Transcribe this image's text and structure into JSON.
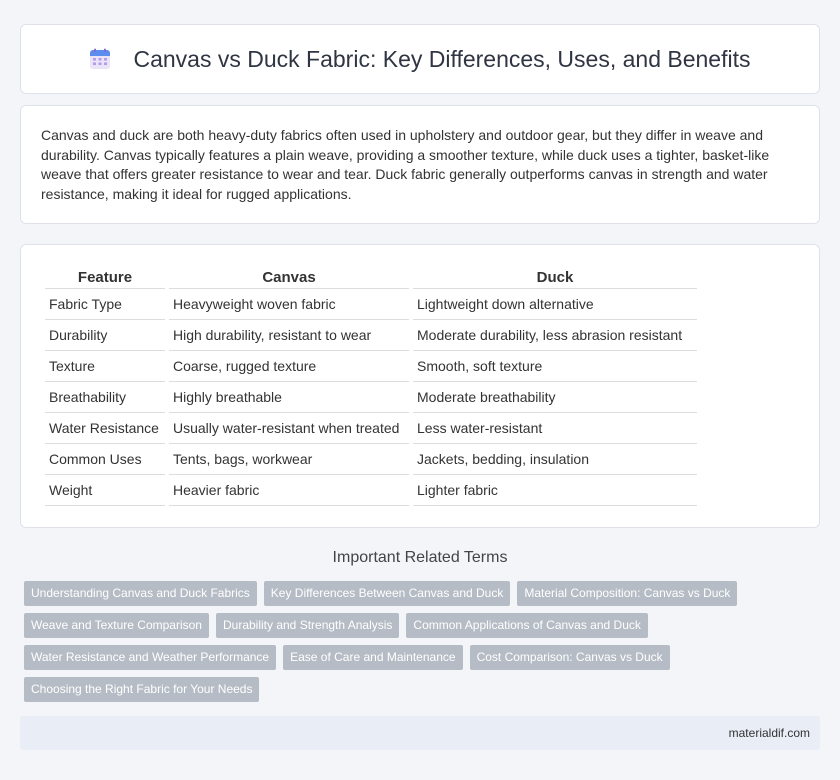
{
  "header": {
    "title": "Canvas vs Duck Fabric: Key Differences, Uses, and Benefits",
    "icon": "calendar-icon"
  },
  "intro": {
    "text": "Canvas and duck are both heavy-duty fabrics often used in upholstery and outdoor gear, but they differ in weave and durability. Canvas typically features a plain weave, providing a smoother texture, while duck uses a tighter, basket-like weave that offers greater resistance to wear and tear. Duck fabric generally outperforms canvas in strength and water resistance, making it ideal for rugged applications."
  },
  "table": {
    "headers": [
      "Feature",
      "Canvas",
      "Duck"
    ],
    "rows": [
      [
        "Fabric Type",
        "Heavyweight woven fabric",
        "Lightweight down alternative"
      ],
      [
        "Durability",
        "High durability, resistant to wear",
        "Moderate durability, less abrasion resistant"
      ],
      [
        "Texture",
        "Coarse, rugged texture",
        "Smooth, soft texture"
      ],
      [
        "Breathability",
        "Highly breathable",
        "Moderate breathability"
      ],
      [
        "Water Resistance",
        "Usually water-resistant when treated",
        "Less water-resistant"
      ],
      [
        "Common Uses",
        "Tents, bags, workwear",
        "Jackets, bedding, insulation"
      ],
      [
        "Weight",
        "Heavier fabric",
        "Lighter fabric"
      ]
    ]
  },
  "related": {
    "title": "Important Related Terms",
    "tags": [
      "Understanding Canvas and Duck Fabrics",
      "Key Differences Between Canvas and Duck",
      "Material Composition: Canvas vs Duck",
      "Weave and Texture Comparison",
      "Durability and Strength Analysis",
      "Common Applications of Canvas and Duck",
      "Water Resistance and Weather Performance",
      "Ease of Care and Maintenance",
      "Cost Comparison: Canvas vs Duck",
      "Choosing the Right Fabric for Your Needs"
    ]
  },
  "footer": {
    "site": "materialdif.com"
  }
}
